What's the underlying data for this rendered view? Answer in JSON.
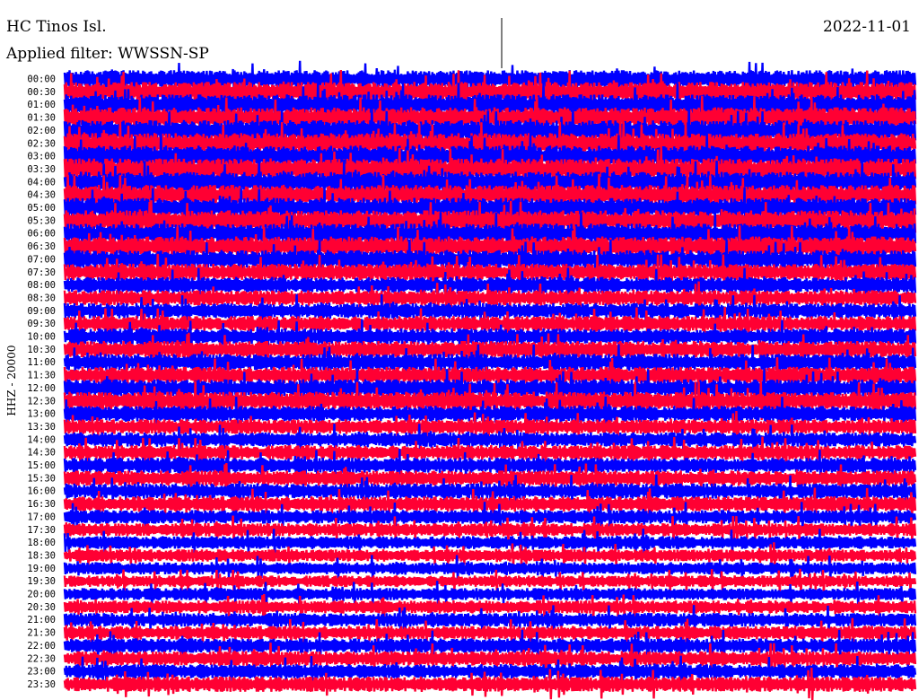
{
  "header": {
    "station": "HC Tinos Isl.",
    "date": "2022-11-01",
    "filter": "Applied filter: WWSSN-SP",
    "channel": "HHZ - 20000"
  },
  "chart_data": {
    "type": "line",
    "title": "HC Tinos Isl.",
    "subtitle": "Applied filter: WWSSN-SP",
    "date": "2022-11-01",
    "ylabel": "HHZ - 20000",
    "xlabel": "",
    "grid": false,
    "legend": "none",
    "colors": [
      "#0000ff",
      "#ff0033"
    ],
    "row_duration_minutes": 30,
    "row_labels": [
      "00:00",
      "00:30",
      "01:00",
      "01:30",
      "02:00",
      "02:30",
      "03:00",
      "03:30",
      "04:00",
      "04:30",
      "05:00",
      "05:30",
      "06:00",
      "06:30",
      "07:00",
      "07:30",
      "08:00",
      "08:30",
      "09:00",
      "09:30",
      "10:00",
      "10:30",
      "11:00",
      "11:30",
      "12:00",
      "12:30",
      "13:00",
      "13:30",
      "14:00",
      "14:30",
      "15:00",
      "15:30",
      "16:00",
      "16:30",
      "17:00",
      "17:30",
      "18:00",
      "18:30",
      "19:00",
      "19:30",
      "20:00",
      "20:30",
      "21:00",
      "21:30",
      "22:00",
      "22:30",
      "23:00",
      "23:30"
    ],
    "relative_amplitude": [
      1.15,
      1.3,
      1.35,
      1.35,
      1.35,
      1.35,
      1.4,
      1.4,
      1.35,
      1.3,
      1.3,
      1.35,
      1.3,
      1.3,
      1.2,
      1.1,
      1.05,
      1.0,
      1.0,
      1.0,
      1.05,
      1.1,
      1.1,
      1.1,
      1.15,
      1.2,
      1.05,
      0.95,
      0.95,
      0.95,
      1.0,
      1.0,
      1.0,
      1.0,
      0.9,
      0.85,
      0.85,
      0.8,
      0.8,
      0.75,
      0.8,
      0.85,
      0.9,
      0.9,
      0.95,
      0.95,
      0.95,
      1.0
    ]
  }
}
